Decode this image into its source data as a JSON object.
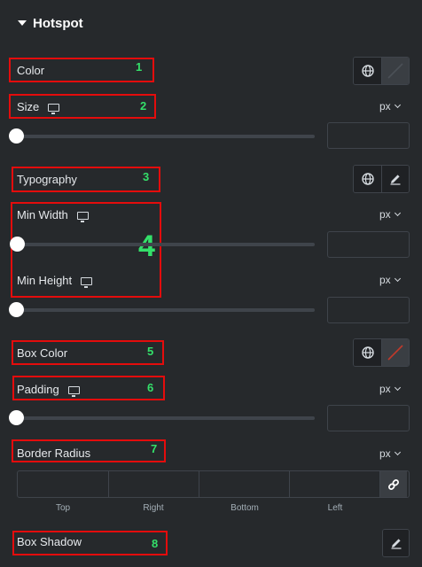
{
  "section": {
    "title": "Hotspot"
  },
  "controls": {
    "color": {
      "label": "Color",
      "marker": "1"
    },
    "size": {
      "label": "Size",
      "unit": "px",
      "marker": "2"
    },
    "typography": {
      "label": "Typography",
      "marker": "3"
    },
    "min_width": {
      "label": "Min Width",
      "unit": "px"
    },
    "min_height": {
      "label": "Min Height",
      "unit": "px"
    },
    "group_marker": "4",
    "box_color": {
      "label": "Box Color",
      "marker": "5"
    },
    "padding": {
      "label": "Padding",
      "unit": "px",
      "marker": "6"
    },
    "border_radius": {
      "label": "Border Radius",
      "unit": "px",
      "marker": "7",
      "sides": [
        "Top",
        "Right",
        "Bottom",
        "Left"
      ]
    },
    "box_shadow": {
      "label": "Box Shadow",
      "marker": "8"
    }
  },
  "slider_positions": {
    "size": 0,
    "min_width": 0,
    "min_height": 0,
    "padding": 0
  },
  "icons": [
    "caret-down-icon",
    "globe-icon",
    "no-color-icon",
    "pencil-icon",
    "monitor-icon",
    "link-icon",
    "chevron-down-icon"
  ],
  "colors": {
    "annotation_box": "#e40c0c",
    "annotation_number": "#34e06a",
    "panel_bg": "#26292c"
  }
}
